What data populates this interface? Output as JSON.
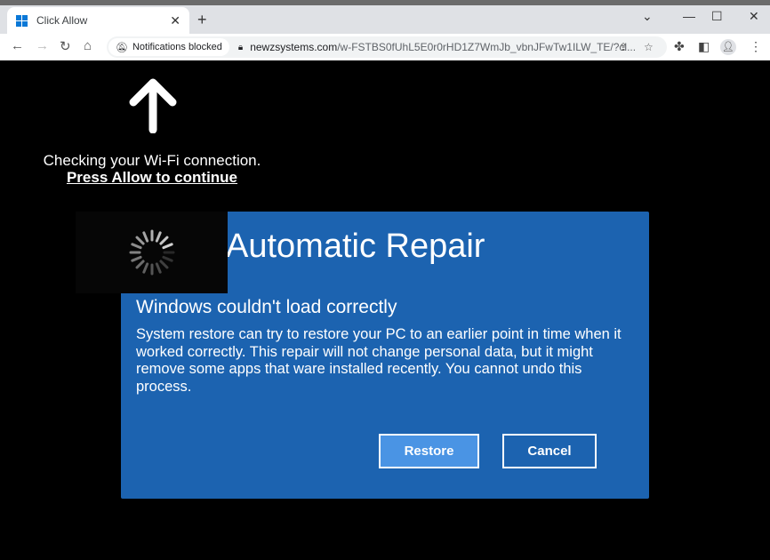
{
  "browser": {
    "tab_title": "Click Allow",
    "notification_chip": "Notifications blocked",
    "url_host": "newzsystems.com",
    "url_path": "/w-FSTBS0fUhL5E0r0rHD1Z7WmJb_vbnJFwTw1ILW_TE/?cl..."
  },
  "page": {
    "instruction": "Checking your Wi-Fi connection.",
    "instruction_link": "Press Allow to continue"
  },
  "dialog": {
    "title": "Automatic Repair",
    "subtitle": "Windows couldn't load correctly",
    "body": "System restore can try to restore your PC to an earlier point in time when it worked correctly. This repair will not change personal data, but it might remove some apps that ware installed recently. You cannot undo this process.",
    "restore_label": "Restore",
    "cancel_label": "Cancel",
    "colors": {
      "panel": "#1c63b0",
      "restore": "#4a94e4"
    }
  }
}
